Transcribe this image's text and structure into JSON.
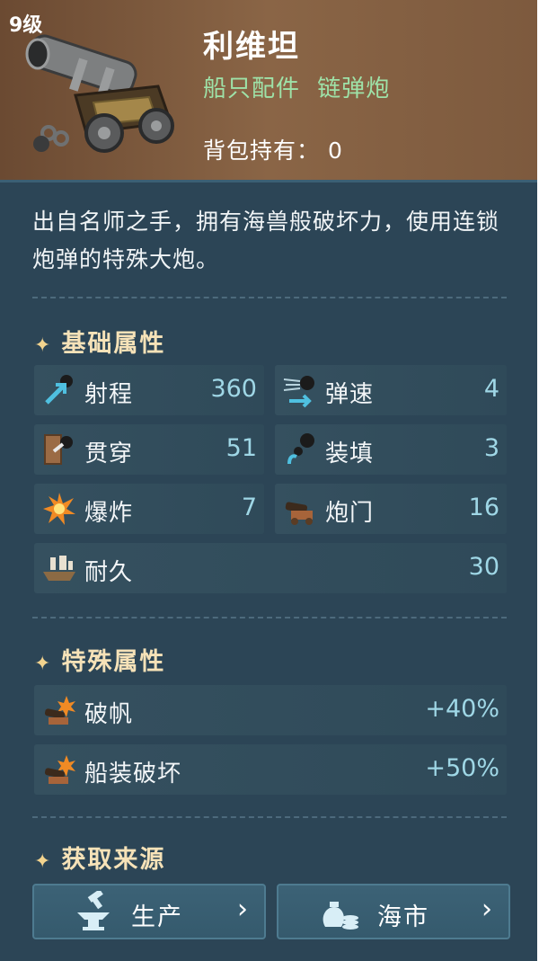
{
  "header": {
    "level": "9级",
    "title": "利维坦",
    "category": "船只配件",
    "subcategory": "链弹炮",
    "owned_label": "背包持有：",
    "owned_value": "0"
  },
  "description": "出自名师之手，拥有海兽般破坏力，使用连锁炮弹的特殊大炮。",
  "basic_section": {
    "title": "基础属性",
    "stats": [
      {
        "label": "射程",
        "value": "360",
        "icon": "range-icon"
      },
      {
        "label": "弹速",
        "value": "4",
        "icon": "shell-speed-icon"
      },
      {
        "label": "贯穿",
        "value": "51",
        "icon": "penetration-icon"
      },
      {
        "label": "装填",
        "value": "3",
        "icon": "reload-icon"
      },
      {
        "label": "爆炸",
        "value": "7",
        "icon": "explosion-icon"
      },
      {
        "label": "炮门",
        "value": "16",
        "icon": "gun-port-icon"
      },
      {
        "label": "耐久",
        "value": "30",
        "icon": "durability-icon"
      }
    ]
  },
  "special_section": {
    "title": "特殊属性",
    "stats": [
      {
        "label": "破帆",
        "value": "+40%",
        "icon": "sail-break-icon"
      },
      {
        "label": "船装破坏",
        "value": "+50%",
        "icon": "ship-equip-break-icon"
      }
    ]
  },
  "source_section": {
    "title": "获取来源",
    "buttons": [
      {
        "label": "生产",
        "icon": "anvil-icon"
      },
      {
        "label": "海市",
        "icon": "money-bag-icon"
      }
    ]
  },
  "colors": {
    "panel_bg": "#2c4556",
    "header_bg": "#8a6546",
    "subtype_green": "#9ee2a8",
    "value_blue": "#9fd7e6",
    "section_gold": "#f6e2b8"
  }
}
